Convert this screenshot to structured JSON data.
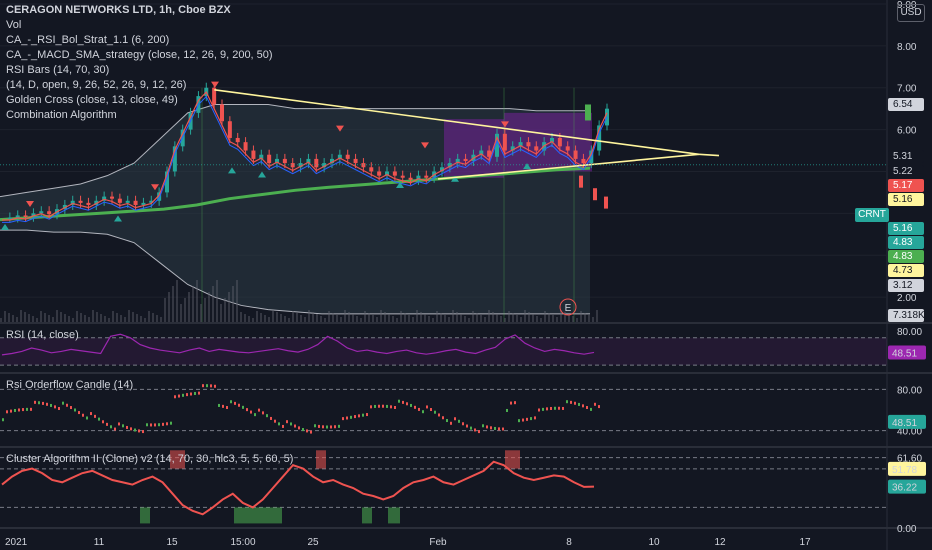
{
  "header": {
    "symbol_line": "CERAGON NETWORKS LTD, 1h, Cboe BZX",
    "currency_button": "USD"
  },
  "main_legend": [
    "Vol",
    "CA_-_RSI_Bol_Strat_1.1 (6, 200)",
    "CA_-_MACD_SMA_strategy (close, 12, 26, 9, 200, 50)",
    "RSI Bars (14, 70, 30)",
    "(14, D, open, 9, 26, 52, 26, 9, 12, 26)",
    "Golden Cross (close, 13, close, 49)",
    "Combination Algorithm"
  ],
  "price_labels": [
    {
      "value": "6.54",
      "bg": "#d1d4dc",
      "fg": "#131722"
    },
    {
      "value": "5.31",
      "bg": "#131722",
      "fg": "#d1d4dc"
    },
    {
      "value": "5.22",
      "bg": "#131722",
      "fg": "#d1d4dc"
    },
    {
      "value": "5.17",
      "bg": "#ef5350",
      "fg": "#ffffff"
    },
    {
      "value": "5.16",
      "bg": "#fff59d",
      "fg": "#131722"
    },
    {
      "value": "5.16",
      "bg": "#26a69a",
      "fg": "#ffffff"
    },
    {
      "value": "4.83",
      "bg": "#26a69a",
      "fg": "#ffffff"
    },
    {
      "value": "4.83",
      "bg": "#4caf50",
      "fg": "#ffffff"
    },
    {
      "value": "4.73",
      "bg": "#fff59d",
      "fg": "#131722"
    },
    {
      "value": "3.12",
      "bg": "#d1d4dc",
      "fg": "#131722"
    },
    {
      "value": "7.318K",
      "bg": "#d1d4dc",
      "fg": "#131722"
    }
  ],
  "crnt_label": "CRNT",
  "earnings_marker": "E",
  "colors": {
    "up": "#26a69a",
    "down": "#ef5350",
    "bg": "#131722",
    "grid": "#1e222d",
    "rsi": "#9c27b0",
    "band_fill": "#7b1fa2"
  },
  "chart_data": [
    {
      "type": "candlestick",
      "title": "CERAGON NETWORKS LTD, 1h, Cboe BZX",
      "ylim": [
        1.5,
        9.0
      ],
      "y_ticks": [
        "9.00",
        "8.00",
        "7.00",
        "6.00",
        "2.00"
      ],
      "x_ticks": [
        "2021",
        "11",
        "15",
        "15:00",
        "25",
        "Feb",
        "8",
        "10",
        "12",
        "17"
      ],
      "price_path": [
        3.9,
        3.9,
        3.95,
        3.92,
        4.0,
        4.05,
        3.98,
        4.1,
        4.2,
        4.3,
        4.25,
        4.2,
        4.3,
        4.4,
        4.35,
        4.25,
        4.3,
        4.2,
        4.25,
        4.3,
        4.5,
        5.0,
        5.6,
        6.0,
        6.4,
        6.8,
        7.0,
        6.6,
        6.2,
        5.8,
        5.7,
        5.5,
        5.3,
        5.4,
        5.2,
        5.3,
        5.2,
        5.1,
        5.2,
        5.3,
        5.1,
        5.2,
        5.3,
        5.4,
        5.3,
        5.2,
        5.1,
        5.0,
        4.9,
        5.0,
        4.9,
        4.85,
        4.8,
        4.9,
        4.85,
        5.0,
        5.1,
        5.2,
        5.3,
        5.25,
        5.4,
        5.5,
        5.35,
        5.9,
        5.5,
        5.6,
        5.7,
        5.6,
        5.5,
        5.7,
        5.8,
        5.6,
        5.5,
        5.3,
        5.2,
        5.5,
        6.1,
        6.5
      ],
      "upper_band": [
        4.4,
        4.5,
        4.6,
        4.7,
        4.9,
        5.2,
        5.8,
        6.4,
        6.6,
        6.6,
        6.6,
        6.5,
        6.5,
        6.5,
        6.5,
        6.5,
        6.5,
        6.5,
        6.5,
        6.5,
        6.45,
        6.45,
        6.45
      ],
      "lower_band": [
        3.6,
        3.6,
        3.55,
        3.55,
        3.5,
        3.3,
        2.8,
        2.3,
        2.0,
        1.8,
        1.7,
        1.65,
        1.6,
        1.6,
        1.6,
        1.6,
        1.6,
        1.6,
        1.6,
        1.6,
        1.6,
        1.6,
        1.6
      ],
      "slow_ma": [
        3.85,
        3.9,
        3.95,
        4.0,
        4.05,
        4.1,
        4.2,
        4.35,
        4.45,
        4.55,
        4.62,
        4.68,
        4.74,
        4.8,
        4.86,
        4.92,
        4.98,
        5.04,
        5.08
      ],
      "trendline_upper": [
        [
          0.23,
          6.95
        ],
        [
          0.75,
          5.41
        ]
      ],
      "trendline_lower": [
        [
          0.47,
          4.82
        ],
        [
          0.75,
          5.41
        ]
      ],
      "volume_label": "7.318K"
    },
    {
      "type": "line",
      "title": "RSI (14, close)",
      "ylim": [
        20,
        90
      ],
      "y_ticks": [
        "80.00"
      ],
      "current": "48.51",
      "values": [
        45,
        47,
        50,
        55,
        52,
        48,
        50,
        53,
        51,
        49,
        47,
        72,
        75,
        70,
        60,
        55,
        52,
        50,
        48,
        52,
        55,
        50,
        53,
        51,
        49,
        48,
        50,
        52,
        54,
        51,
        49,
        53,
        60,
        72,
        65,
        55,
        50,
        52,
        49,
        47,
        50,
        52,
        48,
        46,
        48,
        51,
        53,
        49,
        47,
        52,
        56,
        68,
        74,
        62,
        55,
        50,
        53,
        51,
        48,
        46,
        48.51
      ]
    },
    {
      "type": "bar",
      "title": "Rsi Orderflow Candle (14)",
      "y_ticks": [
        "80.00",
        "40.00"
      ],
      "current": "48.51"
    },
    {
      "type": "line",
      "title": "Cluster Algorithm II (Clone) v2 (14, 70, 30, hlc3, 5, 5, 60, 5)",
      "ylim": [
        0,
        70
      ],
      "y_ticks": [
        "61.60",
        "51.78",
        "0.00"
      ],
      "labels": [
        {
          "value": "51.78",
          "bg": "#fff59d",
          "fg": "#131722"
        },
        {
          "value": "36.22",
          "bg": "#26a69a",
          "fg": "#ffffff"
        }
      ],
      "values": [
        38,
        45,
        50,
        52,
        48,
        42,
        40,
        44,
        48,
        50,
        46,
        42,
        40,
        38,
        42,
        45,
        40,
        30,
        20,
        15,
        12,
        18,
        25,
        30,
        22,
        18,
        25,
        35,
        45,
        55,
        52,
        45,
        40,
        42,
        38,
        35,
        30,
        28,
        25,
        28,
        35,
        40,
        42,
        45,
        40,
        38,
        42,
        46,
        50,
        58,
        55,
        48,
        44,
        42,
        44,
        46,
        45,
        40,
        36,
        36.22
      ]
    }
  ]
}
